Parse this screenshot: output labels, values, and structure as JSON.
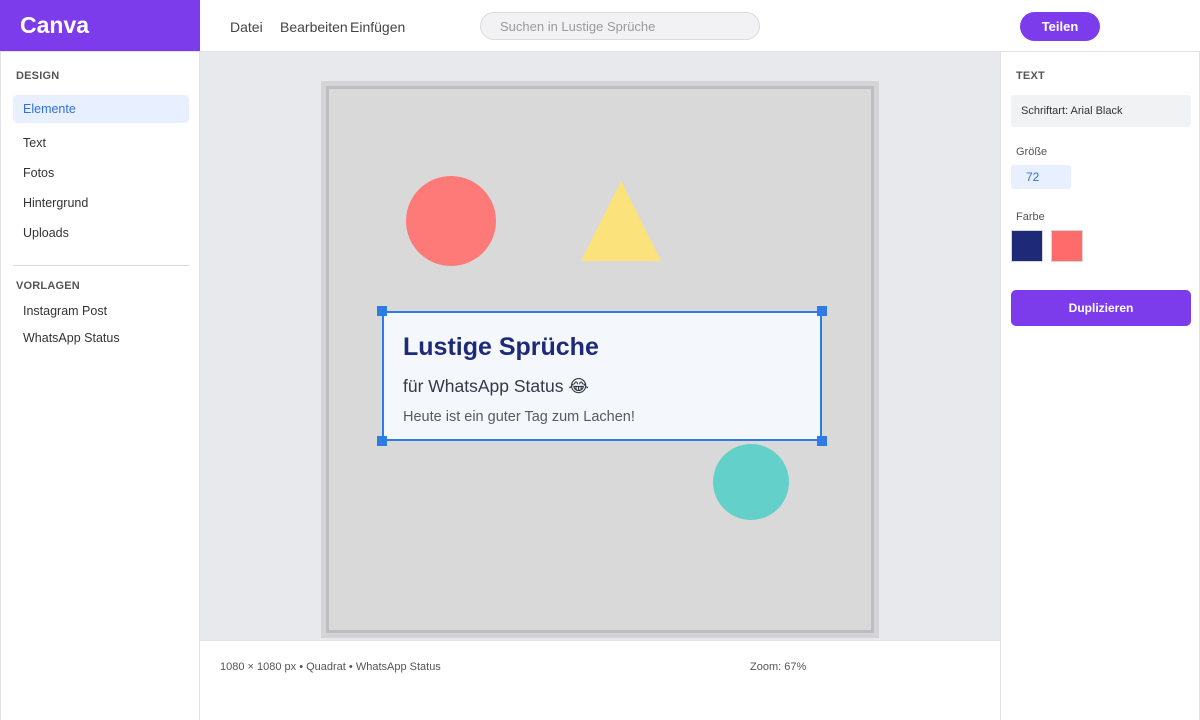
{
  "app": {
    "brand": "Canva"
  },
  "menu": {
    "file": "Datei",
    "edit": "Bearbeiten",
    "insert": "Einfügen"
  },
  "search": {
    "placeholder": "Suchen in Lustige Sprüche",
    "value": ""
  },
  "header": {
    "share_label": "Teilen"
  },
  "sidebar": {
    "design_title": "DESIGN",
    "items": [
      {
        "label": "Elemente",
        "active": true
      },
      {
        "label": "Text"
      },
      {
        "label": "Fotos"
      },
      {
        "label": "Hintergrund"
      },
      {
        "label": "Uploads"
      }
    ],
    "templates_title": "VORLAGEN",
    "templates": [
      {
        "label": "Instagram Post"
      },
      {
        "label": "WhatsApp Status"
      }
    ]
  },
  "canvas": {
    "textbox": {
      "title": "Lustige Sprüche",
      "subtitle": "für WhatsApp Status 😂",
      "body": "Heute ist ein guter Tag zum Lachen!"
    },
    "shape_colors": {
      "circle_red": "#fd7a78",
      "triangle": "#fbe27a",
      "circle_teal": "#64d0ca"
    }
  },
  "status": {
    "info": "1080 × 1080 px • Quadrat • WhatsApp Status",
    "zoom": "Zoom: 67%"
  },
  "panel": {
    "title": "TEXT",
    "font": "Schriftart: Arial Black",
    "size_label": "Größe",
    "size_value": "72",
    "color_label": "Farbe",
    "swatches": [
      "#1e2a78",
      "#fd6b6b"
    ],
    "duplicate_label": "Duplizieren"
  },
  "colors": {
    "accent": "#7d3cec",
    "selection": "#2f7be6"
  }
}
